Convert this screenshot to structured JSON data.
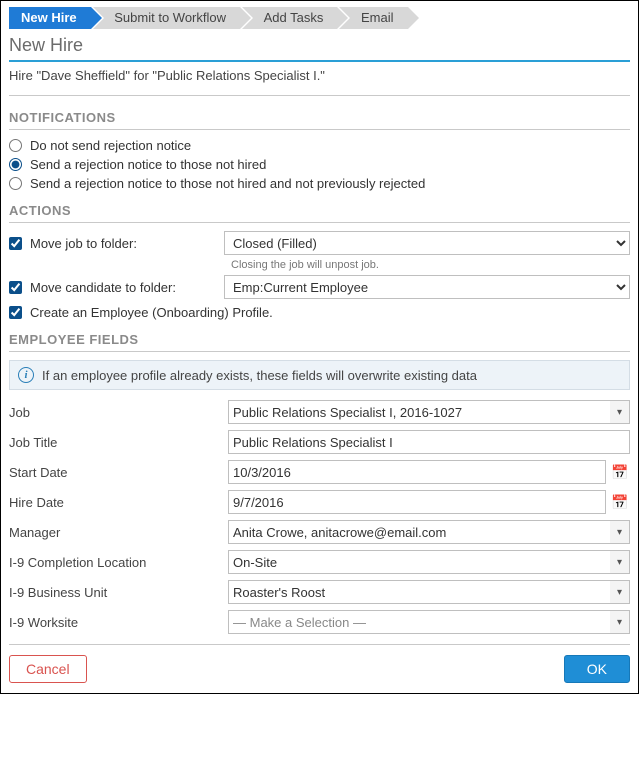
{
  "wizard": {
    "steps": [
      "New Hire",
      "Submit to Workflow",
      "Add Tasks",
      "Email"
    ],
    "active_index": 0
  },
  "page": {
    "title": "New Hire",
    "subtitle": "Hire \"Dave Sheffield\" for \"Public Relations Specialist I.\""
  },
  "notifications": {
    "heading": "NOTIFICATIONS",
    "options": [
      {
        "label": "Do not send rejection notice",
        "checked": false
      },
      {
        "label": "Send a rejection notice to those not hired",
        "checked": true
      },
      {
        "label": "Send a rejection notice to those not hired and not previously rejected",
        "checked": false
      }
    ]
  },
  "actions": {
    "heading": "ACTIONS",
    "move_job": {
      "label": "Move job to folder:",
      "checked": true,
      "value": "Closed (Filled)",
      "hint": "Closing the job will unpost job."
    },
    "move_candidate": {
      "label": "Move candidate to folder:",
      "checked": true,
      "value": "Emp:Current Employee"
    },
    "create_profile": {
      "label": "Create an Employee (Onboarding) Profile.",
      "checked": true
    }
  },
  "employee_fields": {
    "heading": "EMPLOYEE FIELDS",
    "info": "If an employee profile already exists, these fields will overwrite existing data",
    "job": {
      "label": "Job",
      "value": "Public Relations Specialist I, 2016-1027",
      "type": "dropdown"
    },
    "job_title": {
      "label": "Job Title",
      "value": "Public Relations Specialist I",
      "type": "text"
    },
    "start_date": {
      "label": "Start Date",
      "value": "10/3/2016",
      "type": "date"
    },
    "hire_date": {
      "label": "Hire Date",
      "value": "9/7/2016",
      "type": "date"
    },
    "manager": {
      "label": "Manager",
      "value": "Anita Crowe, anitacrowe@email.com",
      "type": "dropdown"
    },
    "i9_location": {
      "label": "I-9 Completion Location",
      "value": "On-Site",
      "type": "dropdown"
    },
    "i9_bu": {
      "label": "I-9 Business Unit",
      "value": "Roaster's Roost",
      "type": "dropdown"
    },
    "i9_worksite": {
      "label": "I-9 Worksite",
      "value": "— Make a Selection —",
      "type": "dropdown",
      "placeholder": true
    }
  },
  "footer": {
    "cancel": "Cancel",
    "ok": "OK"
  },
  "icons": {
    "dropdown": "▾",
    "calendar": "📅",
    "info": "i"
  }
}
